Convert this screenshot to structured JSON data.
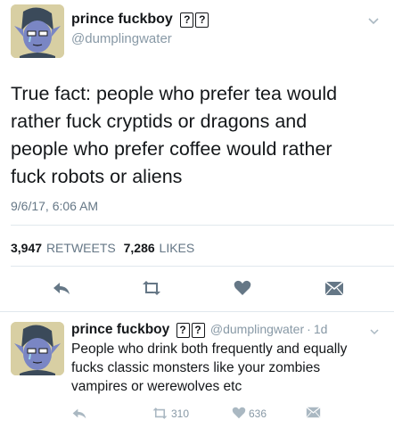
{
  "main_tweet": {
    "display_name": "prince fuckboy",
    "name_glyphs": [
      "?",
      "?"
    ],
    "handle": "@dumplingwater",
    "text_lines": [
      "True fact: people who prefer tea would",
      "rather fuck cryptids or dragons and",
      "people who prefer coffee would rather",
      "fuck robots or aliens"
    ],
    "timestamp": "9/6/17, 6:06 AM",
    "retweet_count": "3,947",
    "retweet_label": "RETWEETS",
    "like_count": "7,286",
    "like_label": "LIKES",
    "actions": [
      "reply-icon",
      "retweet-icon",
      "heart-icon",
      "direct-message-icon"
    ]
  },
  "reply_tweet": {
    "display_name": "prince fuckboy",
    "name_glyphs": [
      "?",
      "?"
    ],
    "handle": "@dumplingwater",
    "time_sep": "·",
    "time": "1d",
    "text_lines": [
      "People who drink both frequently and equally",
      "fucks classic monsters like your zombies",
      "vampires or werewolves etc"
    ],
    "retweet_count": "310",
    "like_count": "636",
    "actions": [
      "reply-icon",
      "retweet-icon",
      "heart-icon",
      "direct-message-icon"
    ]
  },
  "colors": {
    "text": "#14171a",
    "muted": "#657786",
    "icon_dark": "#657786",
    "icon_light": "#aab8c2",
    "divider": "#e1e8ed"
  }
}
